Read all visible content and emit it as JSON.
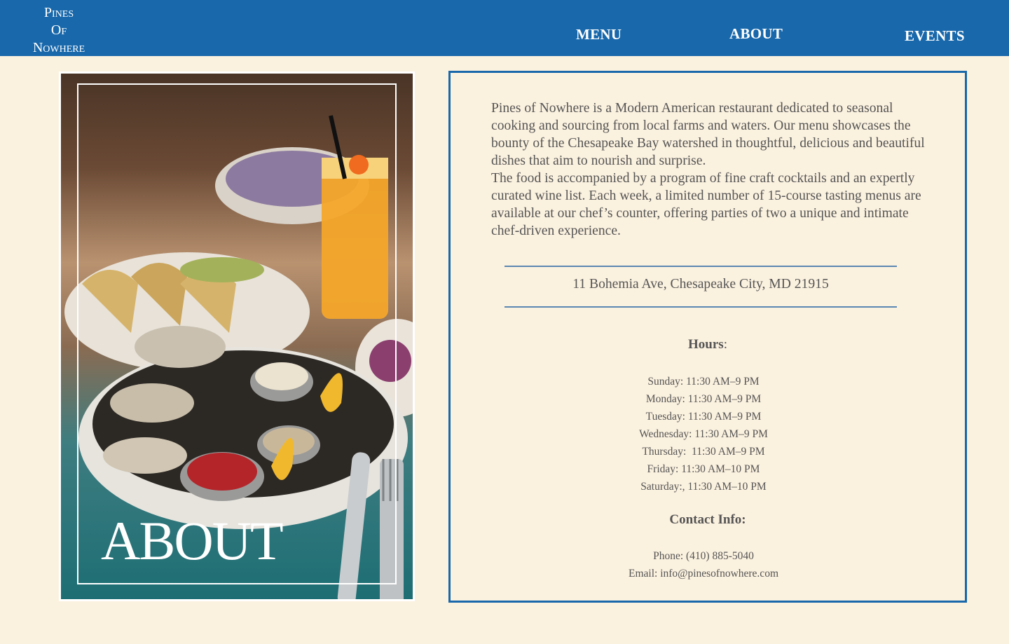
{
  "brand": {
    "logo_lines": [
      "Pines",
      "Of",
      "Nowhere"
    ]
  },
  "nav": {
    "menu": "MENU",
    "about": "ABOUT",
    "events": "EVENTS"
  },
  "hero": {
    "title": "ABOUT"
  },
  "about": {
    "paragraph1": "Pines of Nowhere is a Modern American restaurant dedicated to seasonal cooking and sourcing from local farms and waters. Our menu showcases the bounty of the Chesapeake Bay watershed in thoughtful, delicious and beautiful dishes that aim to nourish and surprise.",
    "paragraph2": "The food is accompanied by a program of fine craft cocktails and an expertly curated wine list. Each week, a limited number of 15-course tasting menus are available at our chef’s counter, offering parties of two a unique and intimate chef-driven experience.",
    "address": "11 Bohemia Ave, Chesapeake City, MD 21915"
  },
  "hours": {
    "title": "Hours",
    "title_suffix": ":",
    "items": [
      "Sunday: 11:30 AM–9 PM",
      "Monday: 11:30 AM–9 PM",
      "Tuesday: 11:30 AM–9 PM",
      "Wednesday: 11:30 AM–9 PM",
      "Thursday:  11:30 AM–9 PM",
      "Friday: 11:30 AM–10 PM",
      "Saturday:, 11:30 AM–10 PM"
    ]
  },
  "contact": {
    "title": "Contact Info:",
    "phone": "Phone: (410) 885-5040",
    "email": "Email: info@pinesofnowhere.com"
  },
  "colors": {
    "brand_blue": "#1868ab",
    "background": "#fbf1df",
    "text": "#555555"
  }
}
